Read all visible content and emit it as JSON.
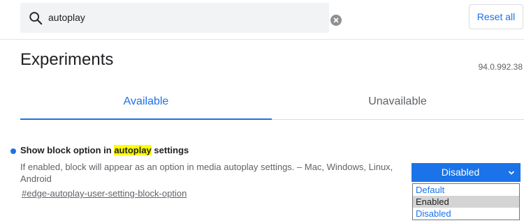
{
  "search": {
    "value": "autoplay",
    "icon": "search-icon",
    "clear_icon": "clear-icon"
  },
  "header": {
    "reset_label": "Reset all",
    "title": "Experiments",
    "version": "94.0.992.38"
  },
  "tabs": [
    {
      "label": "Available",
      "active": true
    },
    {
      "label": "Unavailable",
      "active": false
    }
  ],
  "experiment": {
    "name_prefix": "Show block option in ",
    "name_highlight": "autoplay",
    "name_suffix": " settings",
    "description": "If enabled, block will appear as an option in media autoplay settings. – Mac, Windows, Linux, Android",
    "link": "#edge-autoplay-user-setting-block-option",
    "select_value": "Disabled",
    "options": [
      "Default",
      "Enabled",
      "Disabled"
    ],
    "highlighted_option": "Enabled"
  },
  "colors": {
    "accent": "#1a73e8",
    "highlight": "#ffff00"
  }
}
